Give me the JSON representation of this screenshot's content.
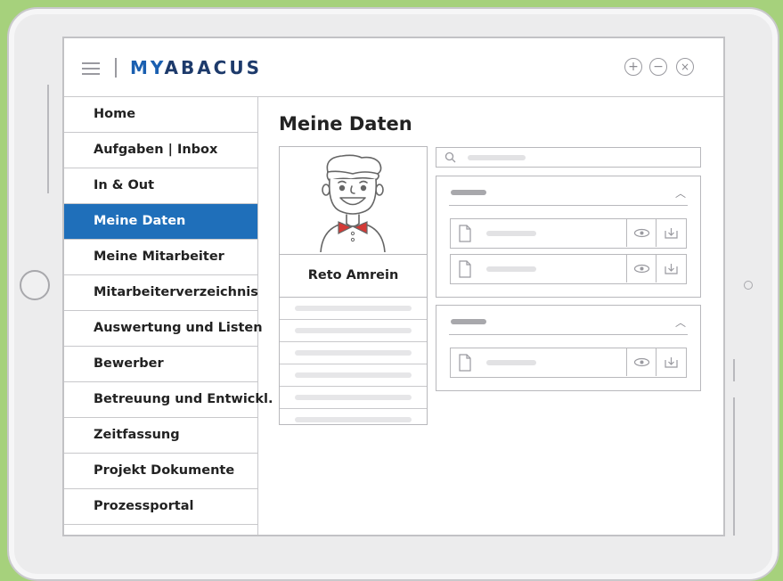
{
  "app": {
    "brand_prefix": "MY",
    "brand_suffix": "ABACUS"
  },
  "window_controls": [
    "add-icon",
    "minimize-icon",
    "close-icon"
  ],
  "sidebar": {
    "items": [
      {
        "label": "Home",
        "active": false
      },
      {
        "label": "Aufgaben | Inbox",
        "active": false
      },
      {
        "label": "In & Out",
        "active": false
      },
      {
        "label": "Meine Daten",
        "active": true
      },
      {
        "label": "Meine Mitarbeiter",
        "active": false
      },
      {
        "label": "Mitarbeiterverzeichnis",
        "active": false
      },
      {
        "label": "Auswertung und Listen",
        "active": false
      },
      {
        "label": "Bewerber",
        "active": false
      },
      {
        "label": "Betreuung und Entwickl.",
        "active": false
      },
      {
        "label": "Zeitfassung",
        "active": false
      },
      {
        "label": "Projekt Dokumente",
        "active": false
      },
      {
        "label": "Prozessportal",
        "active": false
      }
    ]
  },
  "main": {
    "title": "Meine Daten",
    "profile": {
      "name": "Reto Amrein"
    }
  },
  "colors": {
    "accent": "#1f6fba",
    "brand": "#1d3a6b",
    "background": "#a6d17c"
  }
}
